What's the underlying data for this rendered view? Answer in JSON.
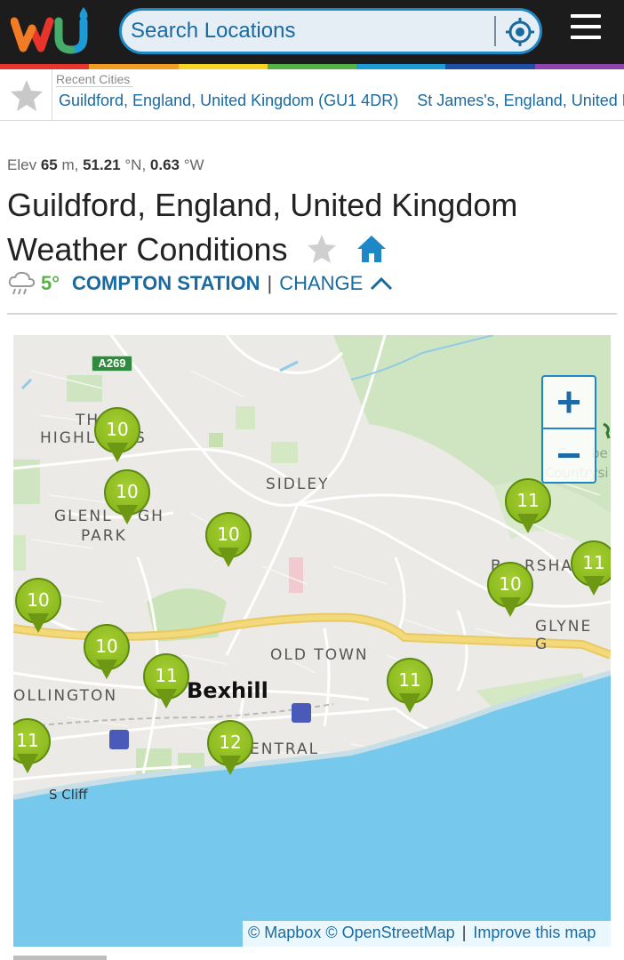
{
  "header": {
    "logo_alt": "wu",
    "search_placeholder": "Search Locations",
    "colors": {
      "background": "#1c1c1c",
      "accent": "#1e88c7"
    },
    "rainbow": [
      "#e8352b",
      "#f39c24",
      "#f5d424",
      "#55b046",
      "#1c9bd7",
      "#1e4ea8",
      "#8e44ad"
    ]
  },
  "recent": {
    "label": "Recent Cities",
    "cities": [
      "Guildford, England, United Kingdom (GU1 4DR)",
      "St James's, England, United Kingdom"
    ]
  },
  "location": {
    "elev_prefix": "Elev",
    "elev_value": "65",
    "elev_unit": "m,",
    "lat_value": "51.21",
    "lat_unit": "°N,",
    "lon_value": "0.63",
    "lon_unit": "°W",
    "title_line1": "Guildford, England, United Kingdom",
    "title_line2": "Weather Conditions"
  },
  "station": {
    "temp": "5°",
    "name": "COMPTON STATION",
    "separator": "|",
    "change_label": "CHANGE"
  },
  "map": {
    "road_shield": "A269",
    "labels": {
      "the_highlands": "TH",
      "highlands": "HIGHL",
      "highlands_end": "S",
      "sidley": "SIDLEY",
      "glenleigh": "GLENL",
      "glenleigh_end": "GH",
      "park": "PARK",
      "bersham": "B",
      "bersham_end": "RSHAM",
      "glyne": "GLYNE G",
      "old_town": "OLD TOWN",
      "collington": "OLLINGTON",
      "bexhill": "Bexhill",
      "central": "ENTRAL",
      "s_cliff": "S Cliff",
      "combe_1": "C",
      "combe_2": "be",
      "countryside": "Countrysi"
    },
    "markers": [
      "10",
      "10",
      "10",
      "11",
      "10",
      "11",
      "10",
      "10",
      "11",
      "11",
      "11",
      "12"
    ],
    "zoom_in": "+",
    "zoom_out": "−",
    "attribution": {
      "mapbox": "© Mapbox",
      "osm": "© OpenStreetMap",
      "separator": "|",
      "improve": "Improve this map"
    }
  }
}
